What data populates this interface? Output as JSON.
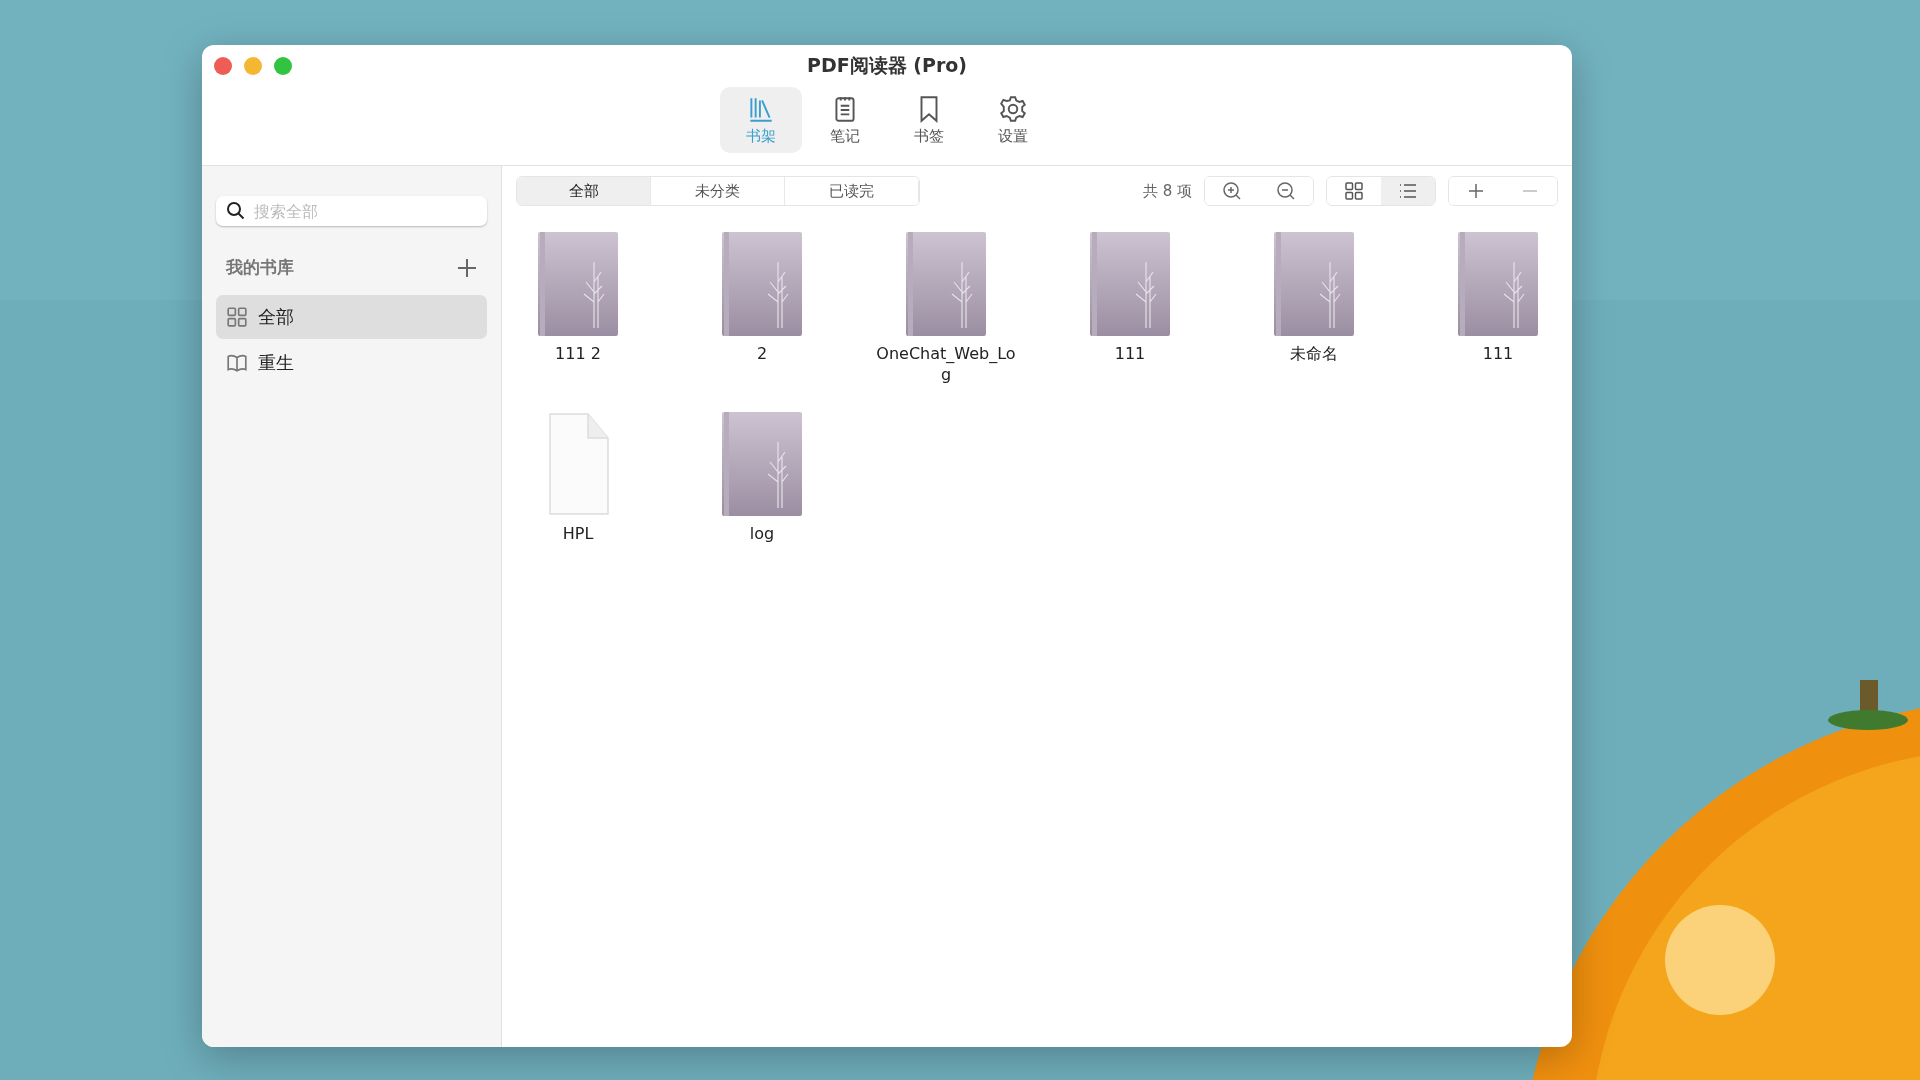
{
  "window": {
    "title": "PDF阅读器 (Pro)"
  },
  "toolbar": [
    {
      "label": "书架",
      "kind": "shelf",
      "selected": true
    },
    {
      "label": "笔记",
      "kind": "notes",
      "selected": false
    },
    {
      "label": "书签",
      "kind": "bookmark",
      "selected": false
    },
    {
      "label": "设置",
      "kind": "settings",
      "selected": false
    }
  ],
  "sidebar": {
    "search": {
      "placeholder": "搜索全部"
    },
    "section": "我的书库",
    "items": [
      {
        "label": "全部",
        "kind": "grid",
        "selected": true
      },
      {
        "label": "重生",
        "kind": "book",
        "selected": false
      }
    ]
  },
  "filters": [
    {
      "label": "全部",
      "selected": true
    },
    {
      "label": "未分类",
      "selected": false
    },
    {
      "label": "已读完",
      "selected": false
    }
  ],
  "count": "共 8 项",
  "view_modes": [
    {
      "kind": "grid",
      "selected": false
    },
    {
      "kind": "list",
      "selected": true
    }
  ],
  "books": [
    {
      "title": "111 2",
      "kind": "book"
    },
    {
      "title": "2",
      "kind": "book"
    },
    {
      "title": "OneChat_Web_Log",
      "kind": "book"
    },
    {
      "title": "111",
      "kind": "book"
    },
    {
      "title": "未命名",
      "kind": "book"
    },
    {
      "title": "111",
      "kind": "book"
    },
    {
      "title": "HPL",
      "kind": "file"
    },
    {
      "title": "log",
      "kind": "book"
    }
  ]
}
